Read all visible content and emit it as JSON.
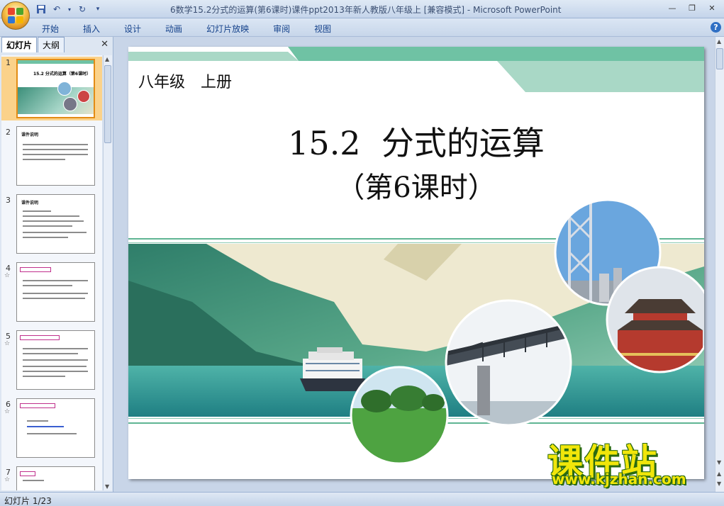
{
  "window": {
    "title": "6数学15.2分式的运算(第6课时)课件ppt2013年新人教版八年级上 [兼容模式] - Microsoft PowerPoint"
  },
  "ribbon": {
    "tabs": [
      "开始",
      "插入",
      "设计",
      "动画",
      "幻灯片放映",
      "审阅",
      "视图"
    ]
  },
  "pane": {
    "tabs": [
      "幻灯片",
      "大纲"
    ]
  },
  "thumbnails": [
    {
      "num": "1",
      "title": "15.2 分式的运算（第6课时）"
    },
    {
      "num": "2",
      "title": "课件说明"
    },
    {
      "num": "3",
      "title": "课件说明"
    },
    {
      "num": "4",
      "title": ""
    },
    {
      "num": "5",
      "title": ""
    },
    {
      "num": "6",
      "title": ""
    },
    {
      "num": "7",
      "title": ""
    }
  ],
  "slide": {
    "grade": "八年级　上册",
    "title": "15.2  分式的运算",
    "subtitle": "（第6课时）"
  },
  "status": {
    "slide_counter": "幻灯片 1/23"
  },
  "watermark": {
    "brand": "课件站",
    "url": "www.kjzhan.com"
  },
  "colors": {
    "teal": "#6fc2a4",
    "accent_orange": "#e38c14",
    "watermark_yellow": "#f1e60a"
  }
}
